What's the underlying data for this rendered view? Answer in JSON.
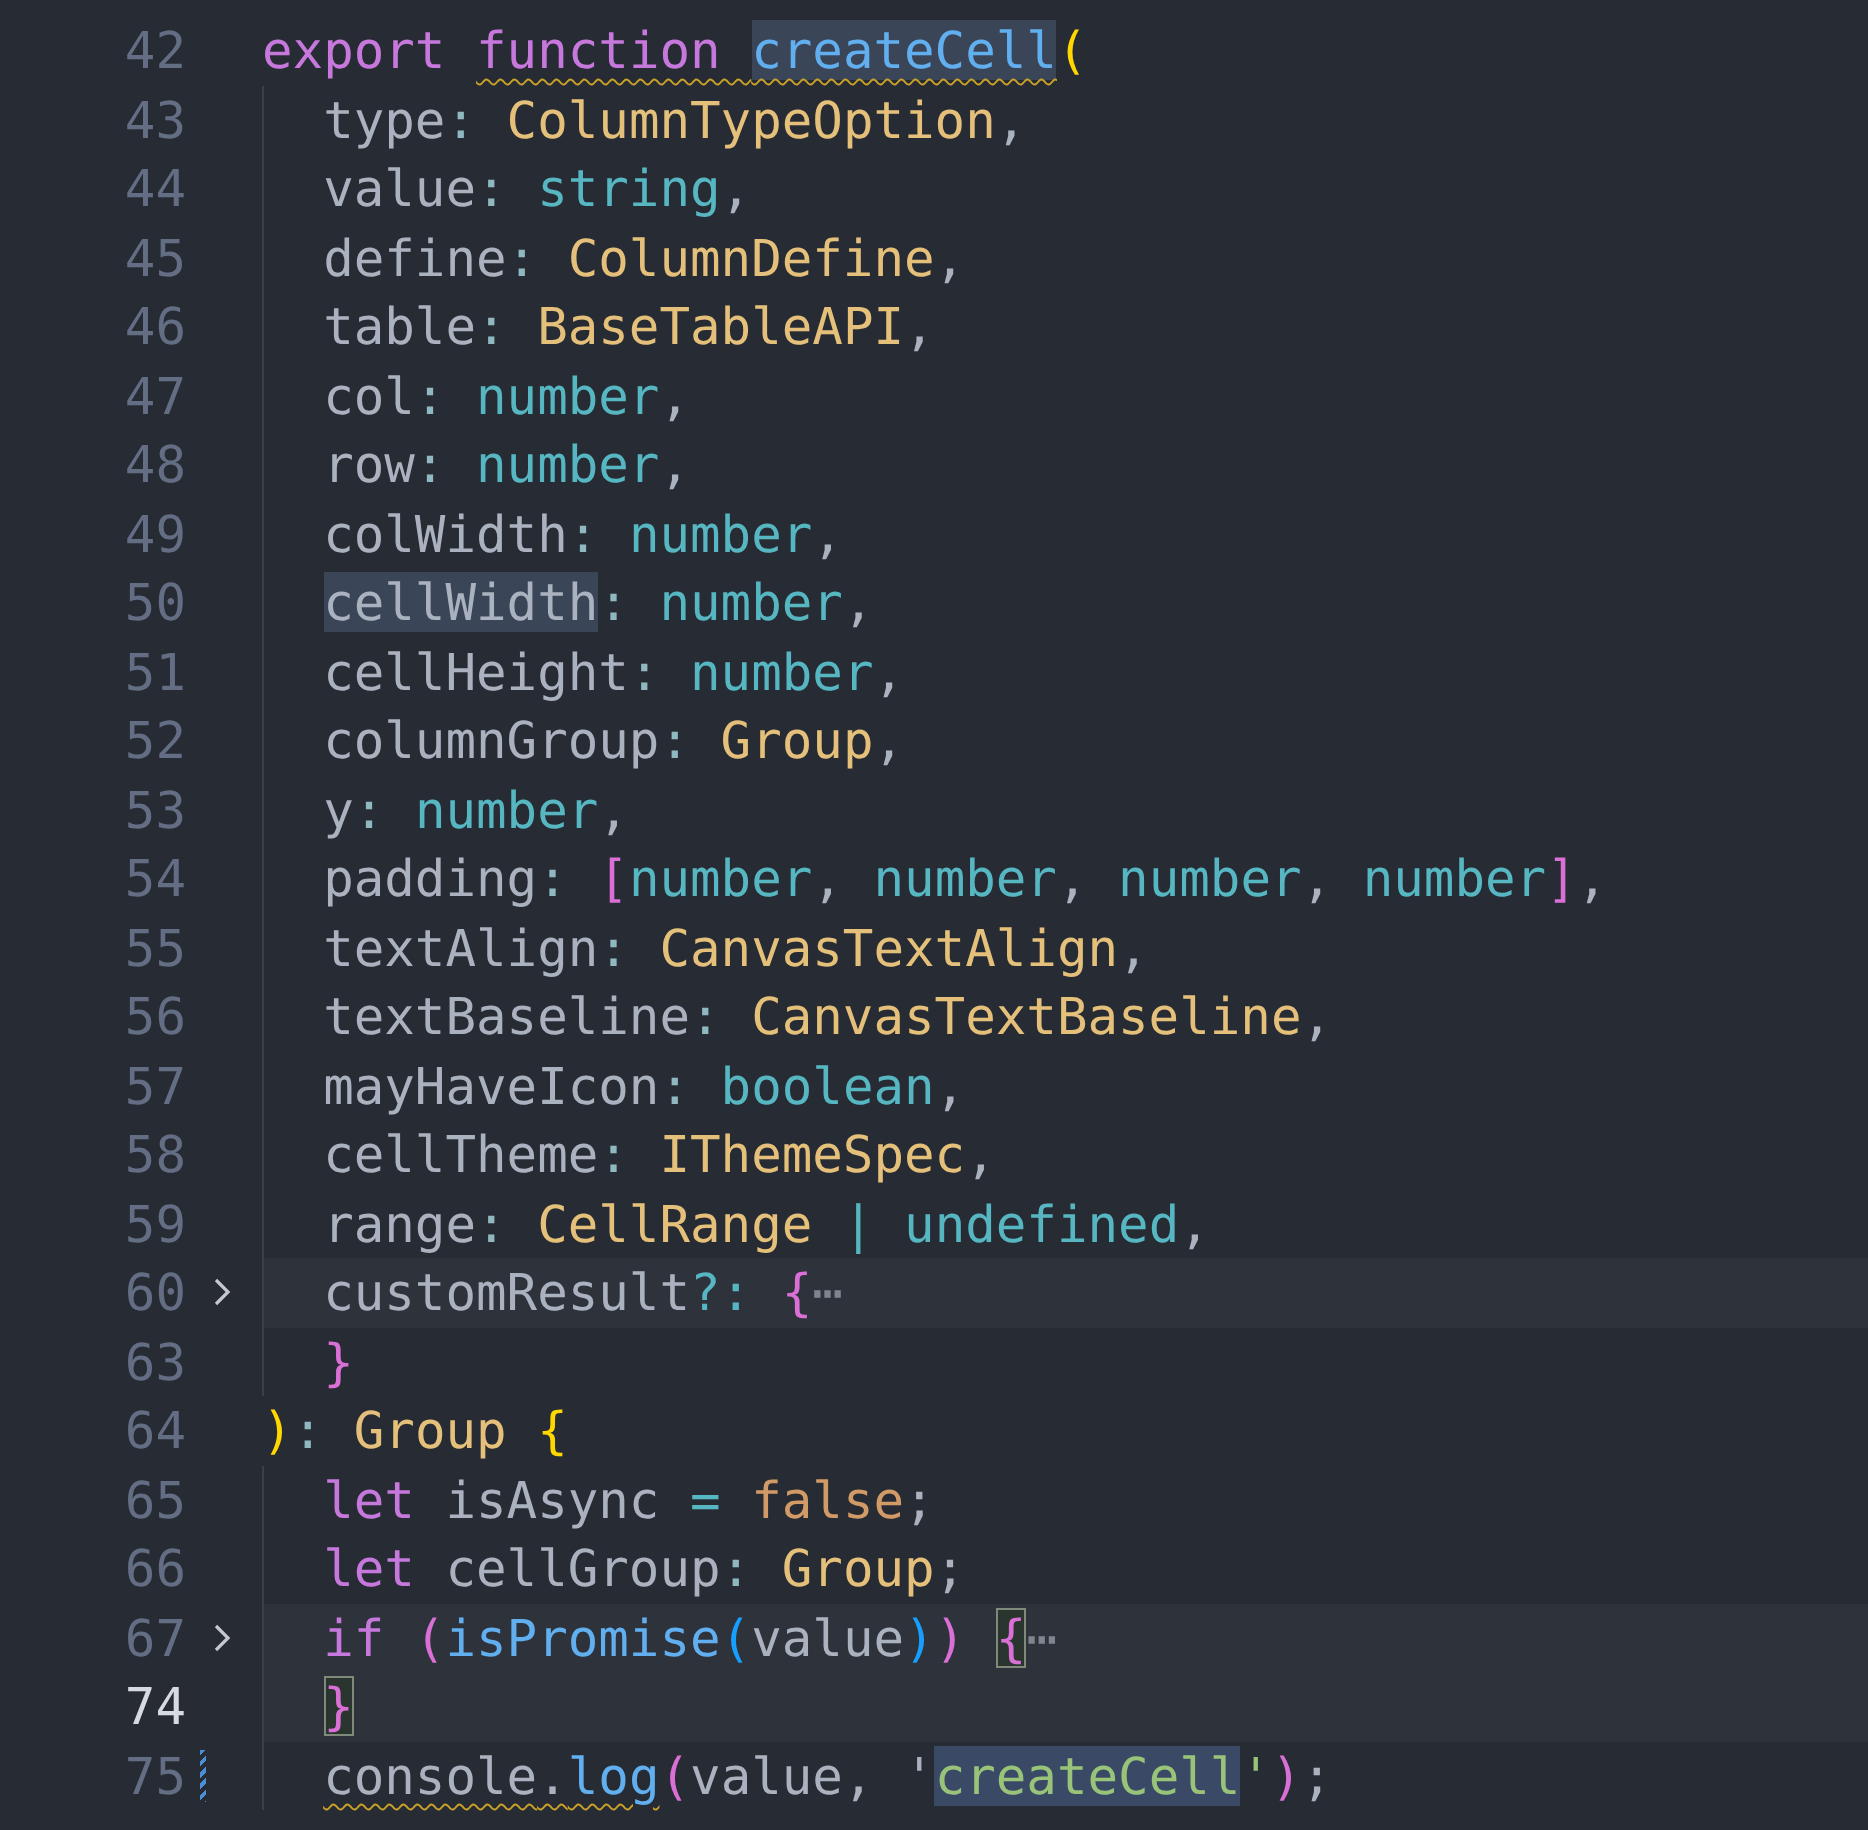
{
  "editor": {
    "lines": [
      {
        "number": "42",
        "folded": false,
        "current": false,
        "modified": false,
        "tokens": [
          {
            "t": "export ",
            "kind": "kw"
          },
          {
            "t": "function ",
            "kind": "kw",
            "squiggle": true
          },
          {
            "t": "createCell",
            "kind": "fn",
            "highlighted": true,
            "squiggle": true
          },
          {
            "t": "(",
            "kind": "b1"
          }
        ],
        "children": [
          {
            "number": "43",
            "folded": false,
            "current": false,
            "modified": false,
            "tokens": [
              {
                "t": "type",
                "kind": "plain"
              },
              {
                "t": ": ",
                "kind": "punc"
              },
              {
                "t": "ColumnTypeOption",
                "kind": "type"
              },
              {
                "t": ",",
                "kind": "plain"
              }
            ]
          },
          {
            "number": "44",
            "folded": false,
            "current": false,
            "modified": false,
            "tokens": [
              {
                "t": "value",
                "kind": "plain"
              },
              {
                "t": ": ",
                "kind": "punc"
              },
              {
                "t": "string",
                "kind": "prim"
              },
              {
                "t": ",",
                "kind": "plain"
              }
            ]
          },
          {
            "number": "45",
            "folded": false,
            "current": false,
            "modified": false,
            "tokens": [
              {
                "t": "define",
                "kind": "plain"
              },
              {
                "t": ": ",
                "kind": "punc"
              },
              {
                "t": "ColumnDefine",
                "kind": "type"
              },
              {
                "t": ",",
                "kind": "plain"
              }
            ]
          },
          {
            "number": "46",
            "folded": false,
            "current": false,
            "modified": false,
            "tokens": [
              {
                "t": "table",
                "kind": "plain"
              },
              {
                "t": ": ",
                "kind": "punc"
              },
              {
                "t": "BaseTableAPI",
                "kind": "type"
              },
              {
                "t": ",",
                "kind": "plain"
              }
            ]
          },
          {
            "number": "47",
            "folded": false,
            "current": false,
            "modified": false,
            "tokens": [
              {
                "t": "col",
                "kind": "plain"
              },
              {
                "t": ": ",
                "kind": "punc"
              },
              {
                "t": "number",
                "kind": "prim"
              },
              {
                "t": ",",
                "kind": "plain"
              }
            ]
          },
          {
            "number": "48",
            "folded": false,
            "current": false,
            "modified": false,
            "tokens": [
              {
                "t": "row",
                "kind": "plain"
              },
              {
                "t": ": ",
                "kind": "punc"
              },
              {
                "t": "number",
                "kind": "prim"
              },
              {
                "t": ",",
                "kind": "plain"
              }
            ]
          },
          {
            "number": "49",
            "folded": false,
            "current": false,
            "modified": false,
            "tokens": [
              {
                "t": "colWidth",
                "kind": "plain"
              },
              {
                "t": ": ",
                "kind": "punc"
              },
              {
                "t": "number",
                "kind": "prim"
              },
              {
                "t": ",",
                "kind": "plain"
              }
            ]
          },
          {
            "number": "50",
            "folded": false,
            "current": false,
            "modified": false,
            "tokens": [
              {
                "t": "cellWidth",
                "kind": "plain",
                "highlighted": true
              },
              {
                "t": ": ",
                "kind": "punc"
              },
              {
                "t": "number",
                "kind": "prim"
              },
              {
                "t": ",",
                "kind": "plain"
              }
            ]
          },
          {
            "number": "51",
            "folded": false,
            "current": false,
            "modified": false,
            "tokens": [
              {
                "t": "cellHeight",
                "kind": "plain"
              },
              {
                "t": ": ",
                "kind": "punc"
              },
              {
                "t": "number",
                "kind": "prim"
              },
              {
                "t": ",",
                "kind": "plain"
              }
            ]
          },
          {
            "number": "52",
            "folded": false,
            "current": false,
            "modified": false,
            "tokens": [
              {
                "t": "columnGroup",
                "kind": "plain"
              },
              {
                "t": ": ",
                "kind": "punc"
              },
              {
                "t": "Group",
                "kind": "type"
              },
              {
                "t": ",",
                "kind": "plain"
              }
            ]
          },
          {
            "number": "53",
            "folded": false,
            "current": false,
            "modified": false,
            "tokens": [
              {
                "t": "y",
                "kind": "plain"
              },
              {
                "t": ": ",
                "kind": "punc"
              },
              {
                "t": "number",
                "kind": "prim"
              },
              {
                "t": ",",
                "kind": "plain"
              }
            ]
          },
          {
            "number": "54",
            "folded": false,
            "current": false,
            "modified": false,
            "tokens": [
              {
                "t": "padding",
                "kind": "plain"
              },
              {
                "t": ": ",
                "kind": "punc"
              },
              {
                "t": "[",
                "kind": "b2"
              },
              {
                "t": "number",
                "kind": "prim"
              },
              {
                "t": ", ",
                "kind": "plain"
              },
              {
                "t": "number",
                "kind": "prim"
              },
              {
                "t": ", ",
                "kind": "plain"
              },
              {
                "t": "number",
                "kind": "prim"
              },
              {
                "t": ", ",
                "kind": "plain"
              },
              {
                "t": "number",
                "kind": "prim"
              },
              {
                "t": "]",
                "kind": "b2"
              },
              {
                "t": ",",
                "kind": "plain"
              }
            ]
          },
          {
            "number": "55",
            "folded": false,
            "current": false,
            "modified": false,
            "tokens": [
              {
                "t": "textAlign",
                "kind": "plain"
              },
              {
                "t": ": ",
                "kind": "punc"
              },
              {
                "t": "CanvasTextAlign",
                "kind": "type"
              },
              {
                "t": ",",
                "kind": "plain"
              }
            ]
          },
          {
            "number": "56",
            "folded": false,
            "current": false,
            "modified": false,
            "tokens": [
              {
                "t": "textBaseline",
                "kind": "plain"
              },
              {
                "t": ": ",
                "kind": "punc"
              },
              {
                "t": "CanvasTextBaseline",
                "kind": "type"
              },
              {
                "t": ",",
                "kind": "plain"
              }
            ]
          },
          {
            "number": "57",
            "folded": false,
            "current": false,
            "modified": false,
            "tokens": [
              {
                "t": "mayHaveIcon",
                "kind": "plain"
              },
              {
                "t": ": ",
                "kind": "punc"
              },
              {
                "t": "boolean",
                "kind": "prim"
              },
              {
                "t": ",",
                "kind": "plain"
              }
            ]
          },
          {
            "number": "58",
            "folded": false,
            "current": false,
            "modified": false,
            "tokens": [
              {
                "t": "cellTheme",
                "kind": "plain"
              },
              {
                "t": ": ",
                "kind": "punc"
              },
              {
                "t": "IThemeSpec",
                "kind": "type"
              },
              {
                "t": ",",
                "kind": "plain"
              }
            ]
          },
          {
            "number": "59",
            "folded": false,
            "current": false,
            "modified": false,
            "tokens": [
              {
                "t": "range",
                "kind": "plain"
              },
              {
                "t": ": ",
                "kind": "punc"
              },
              {
                "t": "CellRange ",
                "kind": "type"
              },
              {
                "t": "| ",
                "kind": "op"
              },
              {
                "t": "undefined",
                "kind": "prim"
              },
              {
                "t": ",",
                "kind": "plain"
              }
            ]
          },
          {
            "number": "60",
            "folded": true,
            "current": false,
            "modified": false,
            "tokens": [
              {
                "t": "customResult",
                "kind": "plain"
              },
              {
                "t": "?: ",
                "kind": "op"
              },
              {
                "t": "{",
                "kind": "b2"
              },
              {
                "t": "⋯",
                "kind": "fold"
              }
            ]
          },
          {
            "number": "63",
            "folded": false,
            "current": false,
            "modified": false,
            "tokens": [
              {
                "t": "}",
                "kind": "b2"
              }
            ]
          }
        ]
      },
      {
        "number": "64",
        "folded": false,
        "current": false,
        "modified": false,
        "tokens": [
          {
            "t": ")",
            "kind": "b1"
          },
          {
            "t": ": ",
            "kind": "punc"
          },
          {
            "t": "Group ",
            "kind": "type"
          },
          {
            "t": "{",
            "kind": "b1"
          }
        ],
        "children": [
          {
            "number": "65",
            "folded": false,
            "current": false,
            "modified": false,
            "tokens": [
              {
                "t": "let ",
                "kind": "kw"
              },
              {
                "t": "isAsync ",
                "kind": "plain"
              },
              {
                "t": "= ",
                "kind": "op"
              },
              {
                "t": "false",
                "kind": "const"
              },
              {
                "t": ";",
                "kind": "plain"
              }
            ]
          },
          {
            "number": "66",
            "folded": false,
            "current": false,
            "modified": false,
            "tokens": [
              {
                "t": "let ",
                "kind": "kw"
              },
              {
                "t": "cellGroup",
                "kind": "plain"
              },
              {
                "t": ": ",
                "kind": "punc"
              },
              {
                "t": "Group",
                "kind": "type"
              },
              {
                "t": ";",
                "kind": "plain"
              }
            ]
          },
          {
            "number": "67",
            "folded": true,
            "current": false,
            "modified": false,
            "tokens": [
              {
                "t": "if ",
                "kind": "kw"
              },
              {
                "t": "(",
                "kind": "b2"
              },
              {
                "t": "isPromise",
                "kind": "fn"
              },
              {
                "t": "(",
                "kind": "b3"
              },
              {
                "t": "value",
                "kind": "plain"
              },
              {
                "t": ")",
                "kind": "b3"
              },
              {
                "t": ") ",
                "kind": "b2"
              },
              {
                "t": "{",
                "kind": "b2",
                "matched": true
              },
              {
                "t": "⋯",
                "kind": "fold"
              }
            ]
          },
          {
            "number": "74",
            "folded": false,
            "current": true,
            "modified": false,
            "tokens": [
              {
                "t": "}",
                "kind": "b2",
                "matched": true
              }
            ]
          },
          {
            "number": "75",
            "folded": false,
            "current": false,
            "modified": true,
            "tokens": [
              {
                "t": "console",
                "kind": "plain",
                "squiggle": true
              },
              {
                "t": ".",
                "kind": "plain",
                "squiggle": true
              },
              {
                "t": "log",
                "kind": "fn",
                "squiggle": true
              },
              {
                "t": "(",
                "kind": "b2"
              },
              {
                "t": "value, '",
                "kind": "plain"
              },
              {
                "t": "createCell",
                "kind": "str",
                "highlighted": true
              },
              {
                "t": "'",
                "kind": "str"
              },
              {
                "t": ")",
                "kind": "b2"
              },
              {
                "t": ";",
                "kind": "plain"
              }
            ]
          }
        ]
      }
    ]
  }
}
